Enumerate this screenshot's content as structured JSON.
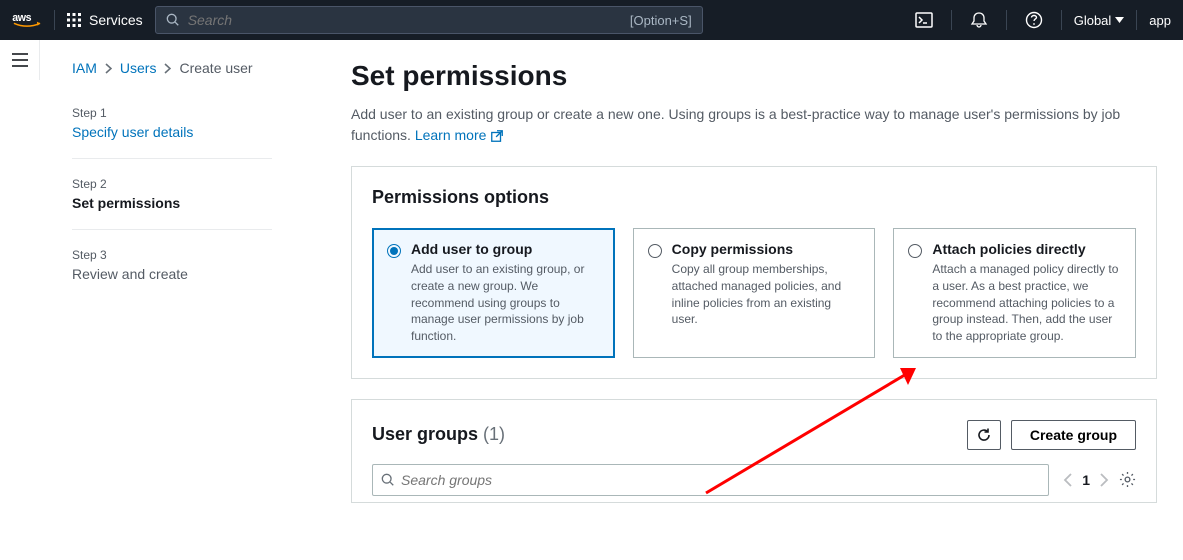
{
  "navbar": {
    "services_label": "Services",
    "search_placeholder": "Search",
    "search_hotkey": "[Option+S]",
    "region": "Global",
    "account": "app"
  },
  "breadcrumb": {
    "iam": "IAM",
    "users": "Users",
    "current": "Create user"
  },
  "steps": [
    {
      "num": "Step 1",
      "title": "Specify user details"
    },
    {
      "num": "Step 2",
      "title": "Set permissions"
    },
    {
      "num": "Step 3",
      "title": "Review and create"
    }
  ],
  "page": {
    "heading": "Set permissions",
    "subtitle_pre": "Add user to an existing group or create a new one. Using groups is a best-practice way to manage user's permissions by job functions. ",
    "learn_more": "Learn more"
  },
  "permissions": {
    "heading": "Permissions options",
    "options": [
      {
        "title": "Add user to group",
        "desc": "Add user to an existing group, or create a new group. We recommend using groups to manage user permissions by job function."
      },
      {
        "title": "Copy permissions",
        "desc": "Copy all group memberships, attached managed policies, and inline policies from an existing user."
      },
      {
        "title": "Attach policies directly",
        "desc": "Attach a managed policy directly to a user. As a best practice, we recommend attaching policies to a group instead. Then, add the user to the appropriate group."
      }
    ]
  },
  "groups": {
    "heading": "User groups",
    "count": "(1)",
    "create_btn": "Create group",
    "search_placeholder": "Search groups",
    "page": "1"
  }
}
